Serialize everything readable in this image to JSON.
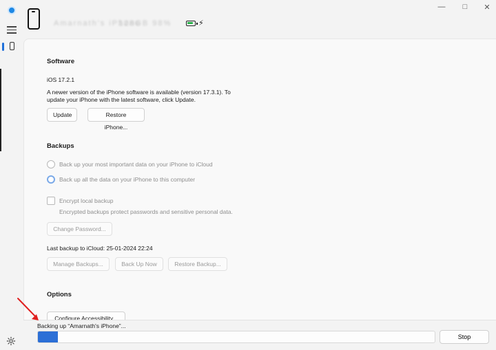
{
  "header": {
    "device_name": "Amarnath's iPhone",
    "device_info": "128GB 98%"
  },
  "software": {
    "title": "Software",
    "version": "iOS 17.2.1",
    "message_line1": "A newer version of the iPhone software is available (version 17.3.1). To",
    "message_line2": "update your iPhone with the latest software, click Update.",
    "update_label": "Update",
    "restore_label": "Restore iPhone..."
  },
  "backups": {
    "title": "Backups",
    "option_icloud": "Back up your most important data on your iPhone to iCloud",
    "option_computer": "Back up all the data on your iPhone to this computer",
    "encrypt_label": "Encrypt local backup",
    "encrypt_desc": "Encrypted backups protect passwords and sensitive personal data.",
    "change_password_label": "Change Password...",
    "last_backup": "Last backup to iCloud: 25-01-2024 22:24",
    "manage_label": "Manage Backups...",
    "backup_now_label": "Back Up Now",
    "restore_backup_label": "Restore Backup..."
  },
  "options": {
    "title": "Options",
    "accessibility_label": "Configure Accessibility..."
  },
  "status": {
    "text": "Backing up “Amarnath's iPhone”...",
    "progress": 0.05,
    "stop_label": "Stop"
  },
  "window_controls": {
    "minimize": "—",
    "maximize": "□",
    "close": "✕"
  },
  "colors": {
    "accent": "#2c6fd6",
    "battery": "#2bb24c",
    "annotation_arrow": "#e02020"
  }
}
